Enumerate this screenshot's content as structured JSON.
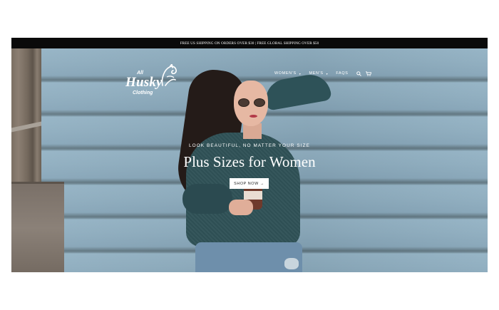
{
  "announcement": "FREE US SHIPPING ON ORDERS OVER $30 | FREE GLOBAL SHIPPING OVER $50",
  "logo": {
    "top": "All",
    "main": "Husky",
    "bottom": "Clothing"
  },
  "nav": {
    "items": [
      {
        "label": "WOMEN'S",
        "has_dropdown": true
      },
      {
        "label": "MEN'S",
        "has_dropdown": true
      },
      {
        "label": "FAQS",
        "has_dropdown": false
      }
    ],
    "icons": [
      "search-icon",
      "cart-icon"
    ],
    "caret": "▾"
  },
  "hero": {
    "subheading": "LOOK BEAUTIFUL, NO MATTER YOUR SIZE",
    "heading": "Plus Sizes for Women",
    "cta_label": "SHOP NOW →",
    "slides": 4,
    "active_slide": 1
  },
  "colors": {
    "announcement_bg": "#0a0a0a",
    "text_on_hero": "#ffffff",
    "page_bg": "#ffffff"
  }
}
